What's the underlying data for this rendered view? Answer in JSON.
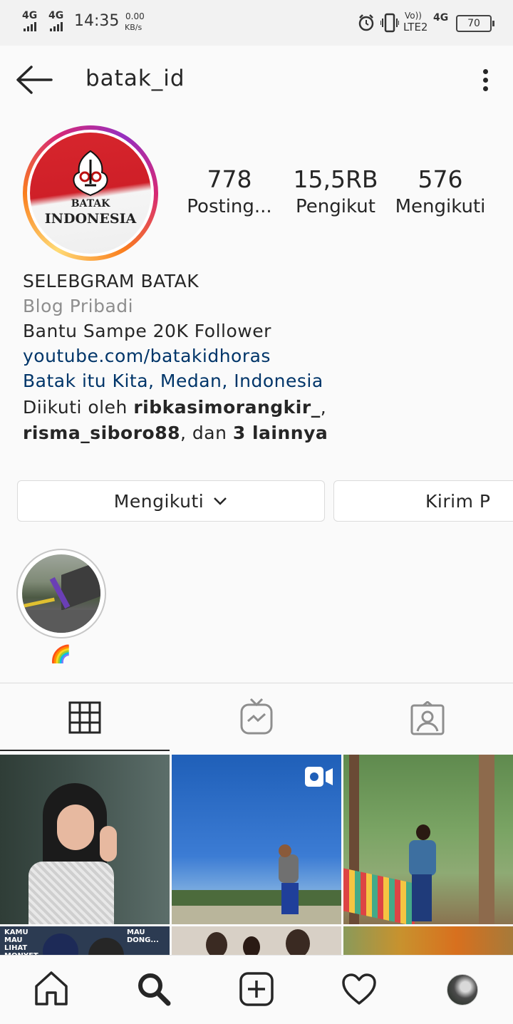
{
  "status_bar": {
    "network1": "4G",
    "network2": "4G",
    "time": "14:35",
    "speed_value": "0.00",
    "speed_unit": "KB/s",
    "volte_top": "Vo))",
    "volte_bottom": "LTE2",
    "network3": "4G",
    "battery": "70"
  },
  "header": {
    "username": "batak_id"
  },
  "avatar": {
    "line1": "BATAK",
    "line2": "INDONESIA"
  },
  "stats": [
    {
      "value": "778",
      "label": "Posting..."
    },
    {
      "value": "15,5RB",
      "label": "Pengikut"
    },
    {
      "value": "576",
      "label": "Mengikuti"
    }
  ],
  "bio": {
    "name": "SELEBGRAM BATAK",
    "category": "Blog Pribadi",
    "text": "Bantu Sampe 20K Follower",
    "website": "youtube.com/batakidhoras",
    "location": "Batak itu Kita, Medan, Indonesia",
    "followed_by_prefix": "Diikuti oleh ",
    "followed_by_user1": "ribkasimorangkir_",
    "followed_by_sep": ",",
    "followed_by_user2": "risma_siboro88",
    "followed_by_mid": ", dan ",
    "followed_by_more": "3 lainnya"
  },
  "buttons": {
    "following": "Mengikuti",
    "message": "Kirim P"
  },
  "highlight": {
    "label_emoji": "🌈"
  },
  "grid_captions": {
    "left": "KAMU MAU LIHAT MONYET NGGAK ?",
    "right": "MAU DONG..."
  },
  "colors": {
    "link": "#003569",
    "muted": "#8e8e8e",
    "text": "#262626"
  },
  "icons": [
    "back-arrow-icon",
    "more-vertical-icon",
    "grid-icon",
    "igtv-icon",
    "tagged-icon",
    "video-icon",
    "home-icon",
    "search-icon",
    "add-icon",
    "heart-icon"
  ]
}
